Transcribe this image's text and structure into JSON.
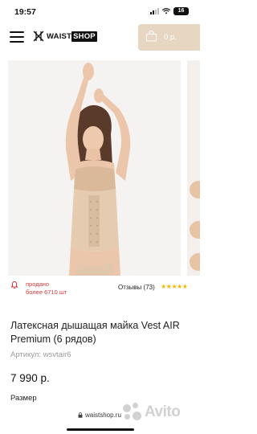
{
  "status_bar": {
    "time": "19:57",
    "battery": "16"
  },
  "header": {
    "logo_prefix": "WAIST",
    "logo_suffix": "SHOP",
    "cart_total": "0 р."
  },
  "gallery": {
    "photo_subject": "woman wearing beige latex vest"
  },
  "product": {
    "sold_line1": "продано",
    "sold_line2": "более 6710 шт",
    "reviews": "Отзывы (73)",
    "rating_stars": "★★★★★",
    "title": "Латексная дышащая майка Vest AIR Premium (6 рядов)",
    "article": "Артикул: wsvtair6",
    "price": "7 990 р.",
    "size_label": "Размер"
  },
  "browser": {
    "url": "waistshop.ru"
  },
  "watermark": {
    "text": "Avito"
  },
  "colors": {
    "accent": "#e7d6c2",
    "sold": "#d63838",
    "stars": "#f3b800"
  }
}
